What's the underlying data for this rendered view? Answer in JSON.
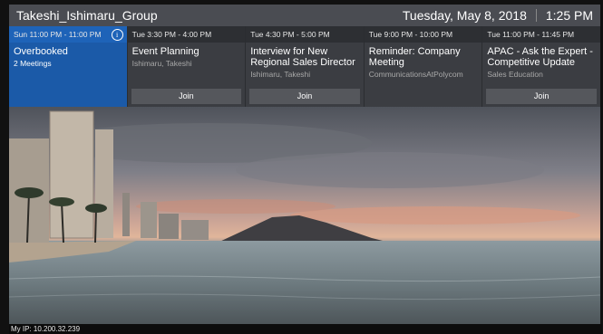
{
  "header": {
    "room_name": "Takeshi_Ishimaru_Group",
    "date": "Tuesday, May 8, 2018",
    "time": "1:25 PM"
  },
  "meetings": [
    {
      "time": "Sun 11:00 PM - 11:00 PM",
      "title": "Overbooked",
      "subtitle": "2 Meetings",
      "join": ""
    },
    {
      "time": "Tue 3:30 PM - 4:00 PM",
      "title": "Event Planning",
      "subtitle": "Ishimaru, Takeshi",
      "join": "Join"
    },
    {
      "time": "Tue 4:30 PM - 5:00 PM",
      "title": "Interview for New Regional Sales Director",
      "subtitle": "Ishimaru, Takeshi",
      "join": "Join"
    },
    {
      "time": "Tue 9:00 PM - 10:00 PM",
      "title": "Reminder: Company Meeting",
      "subtitle": "CommunicationsAtPolycom",
      "join": ""
    },
    {
      "time": "Tue 11:00 PM - 11:45 PM",
      "title": "APAC - Ask the Expert - Competitive Update",
      "subtitle": "Sales Education",
      "join": "Join"
    }
  ],
  "info_icon": "info-icon",
  "footer": {
    "ip": "My IP: 10.200.32.239"
  },
  "colors": {
    "active_card": "#1b5aa8",
    "card": "#3b3d42",
    "header": "#4a4c52"
  }
}
